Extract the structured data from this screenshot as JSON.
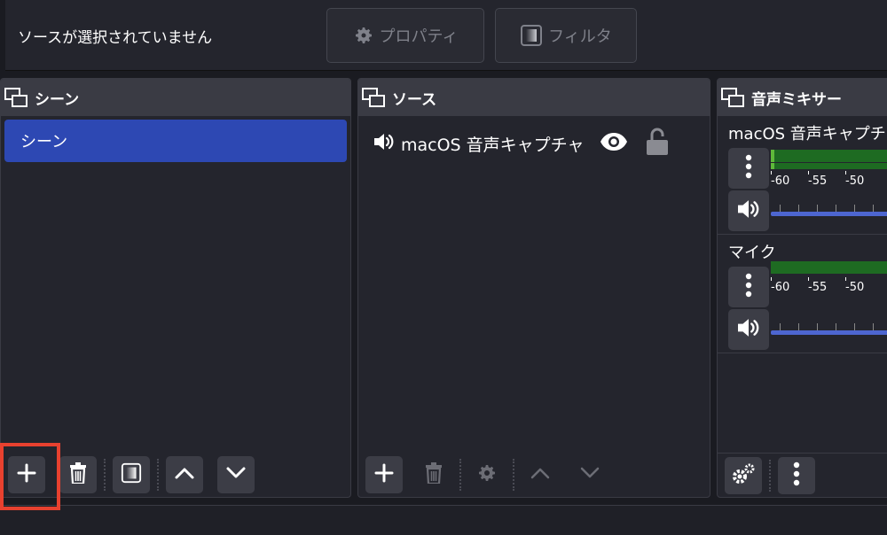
{
  "toolbar": {
    "no_source_text": "ソースが選択されていません",
    "properties_label": "プロパティ",
    "filters_label": "フィルタ"
  },
  "scenes_dock": {
    "title": "シーン",
    "items": [
      {
        "label": "シーン",
        "selected": true
      }
    ]
  },
  "sources_dock": {
    "title": "ソース",
    "items": [
      {
        "label": "macOS 音声キャプチャ",
        "icon": "speaker-icon",
        "visible": true,
        "locked": false
      }
    ]
  },
  "mixer_dock": {
    "title": "音声ミキサー",
    "channels": [
      {
        "name": "macOS 音声キャプチャ",
        "ticks": [
          "-60",
          "-55",
          "-50"
        ]
      },
      {
        "name": "マイク",
        "ticks": [
          "-60",
          "-55",
          "-50"
        ]
      }
    ]
  },
  "colors": {
    "accent_selected": "#2d48b3",
    "highlight_box": "#e8412f",
    "meter_green": "#1e6b22",
    "volume_blue": "#4d66d0"
  }
}
